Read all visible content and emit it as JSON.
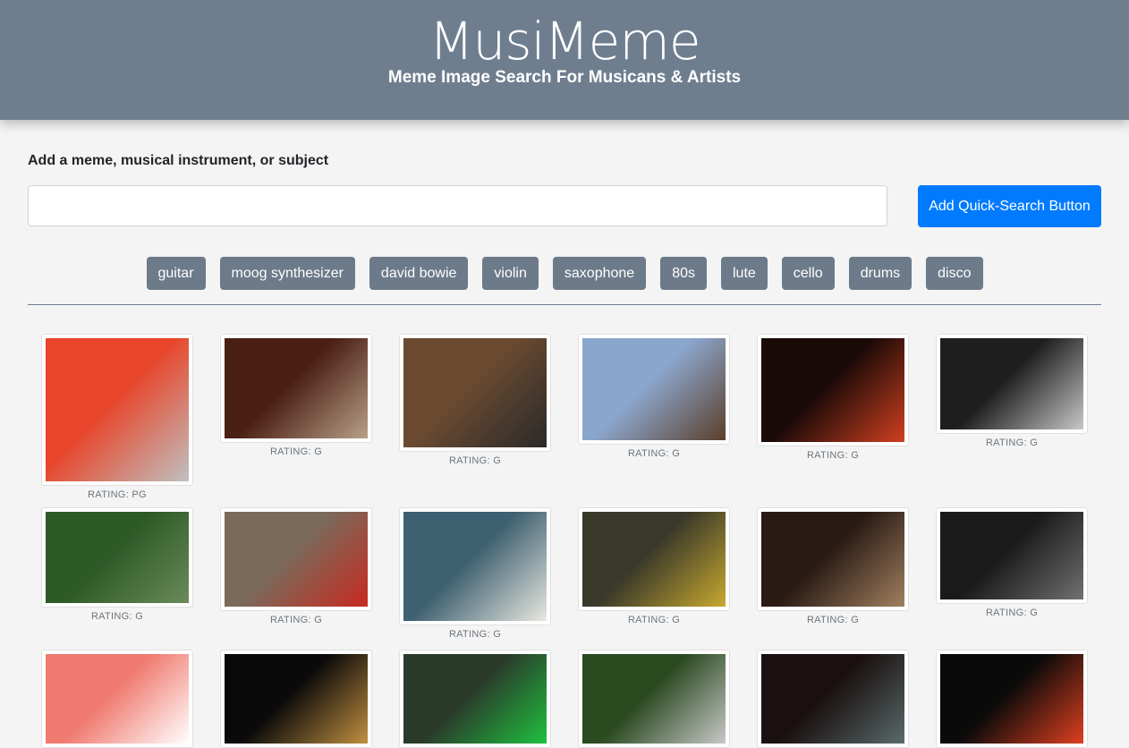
{
  "header": {
    "title": "MusiMeme",
    "subtitle": "Meme Image Search For Musicans & Artists"
  },
  "form": {
    "label": "Add a meme, musical instrument, or subject",
    "input_value": "",
    "placeholder": "",
    "add_button": "Add Quick-Search Button"
  },
  "quick_search": [
    "guitar",
    "moog synthesizer",
    "david bowie",
    "violin",
    "saxophone",
    "80s",
    "lute",
    "cello",
    "drums",
    "disco"
  ],
  "results": [
    {
      "rating": "RATING: PG",
      "palette": [
        "#e8452a",
        "#c0c0c0"
      ]
    },
    {
      "rating": "RATING: G",
      "palette": [
        "#4a1f14",
        "#b8a088"
      ]
    },
    {
      "rating": "RATING: G",
      "palette": [
        "#6a4a30",
        "#2a2a2a"
      ]
    },
    {
      "rating": "RATING: G",
      "palette": [
        "#8ba6cc",
        "#5a3f2a"
      ]
    },
    {
      "rating": "RATING: G",
      "palette": [
        "#1a0a08",
        "#d04020"
      ]
    },
    {
      "rating": "RATING: G",
      "palette": [
        "#1e1e1e",
        "#c8c8c8"
      ]
    },
    {
      "rating": "RATING: G",
      "palette": [
        "#2e5a28",
        "#6a8a5a"
      ]
    },
    {
      "rating": "RATING: G",
      "palette": [
        "#7a6a5a",
        "#c82a20"
      ]
    },
    {
      "rating": "RATING: G",
      "palette": [
        "#3e6070",
        "#e8e8e0"
      ]
    },
    {
      "rating": "RATING: G",
      "palette": [
        "#3a3a2a",
        "#c8a830"
      ]
    },
    {
      "rating": "RATING: G",
      "palette": [
        "#2a1a14",
        "#a08060"
      ]
    },
    {
      "rating": "RATING: G",
      "palette": [
        "#1a1a1a",
        "#707070"
      ]
    },
    {
      "rating": "",
      "palette": [
        "#f07a70",
        "#ffffff"
      ]
    },
    {
      "rating": "",
      "palette": [
        "#0a0a0a",
        "#c09040"
      ]
    },
    {
      "rating": "",
      "palette": [
        "#2a3a2a",
        "#20c040"
      ]
    },
    {
      "rating": "",
      "palette": [
        "#2a4a20",
        "#c8c8c8"
      ]
    },
    {
      "rating": "",
      "palette": [
        "#1a1010",
        "#5a6a6a"
      ]
    },
    {
      "rating": "",
      "palette": [
        "#0a0a0a",
        "#e04020"
      ]
    }
  ]
}
